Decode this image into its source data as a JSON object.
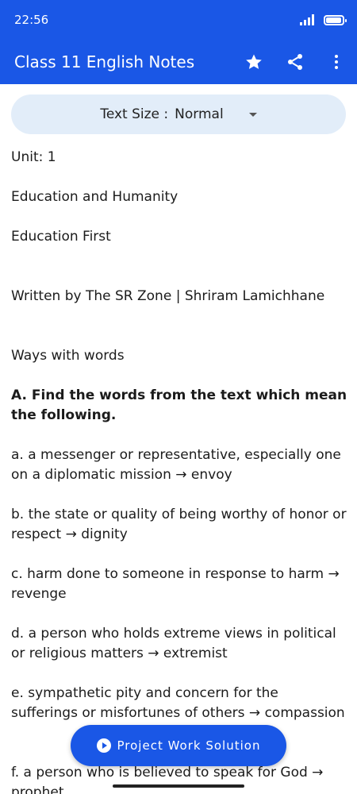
{
  "status": {
    "time": "22:56",
    "battery_level": 0.85
  },
  "app_bar": {
    "title": "Class 11 English Notes",
    "icons": [
      "star-icon",
      "share-icon",
      "more-vert-icon"
    ]
  },
  "text_size": {
    "label": "Text Size :",
    "value": "Normal"
  },
  "article": {
    "unit": "Unit: 1",
    "theme": "Education and Humanity",
    "lesson": "Education First",
    "byline": "Written by The SR Zone | Shriram Lamichhane",
    "section": "Ways with words",
    "question": "A. Find the words from the text which mean the following.",
    "items": [
      "a. a messenger or representative, especially one on a diplomatic mission → envoy",
      "b. the state or quality of being worthy of honor or respect → dignity",
      "c. harm done to someone in response to harm → revenge",
      "d. a person who holds extreme views in political or religious matters → extremist",
      "e. sympathetic pity and concern for the sufferings or misfortunes of others → compassion",
      "f. a person who is believed to speak for God → prophet"
    ]
  },
  "fab": {
    "label": "Project Work Solution"
  },
  "colors": {
    "primary": "#1a57e6",
    "pill": "#e2edf9"
  }
}
